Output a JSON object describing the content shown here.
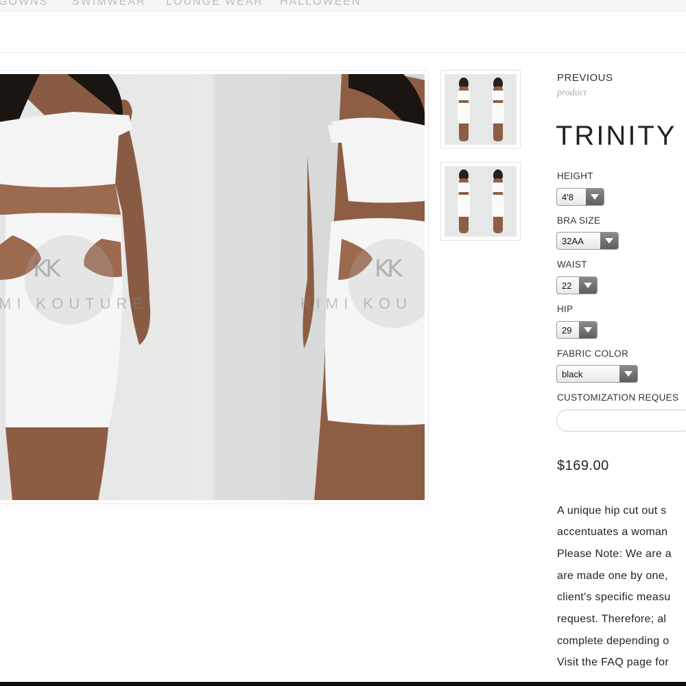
{
  "nav": {
    "items": [
      "GOWNS",
      "SWIMWEAR",
      "LOUNGE WEAR",
      "HALLOWEEN"
    ]
  },
  "gallery": {
    "watermark_left": "MI KOUTURE",
    "watermark_right": "KIMI KOU",
    "logo_mark": "KK"
  },
  "product": {
    "previous_label": "PREVIOUS",
    "previous_sub": "product",
    "title": "TRINITY S",
    "options": {
      "height": {
        "label": "HEIGHT",
        "value": "4'8"
      },
      "bra_size": {
        "label": "BRA SIZE",
        "value": "32AA"
      },
      "waist": {
        "label": "WAIST",
        "value": "22"
      },
      "hip": {
        "label": "HIP",
        "value": "29"
      },
      "fabric_color": {
        "label": "FABRIC COLOR",
        "value": "black"
      },
      "customization": {
        "label": "CUSTOMIZATION REQUES",
        "value": ""
      }
    },
    "price": "$169.00",
    "description": [
      "A unique hip cut out s",
      "accentuates a woman",
      "Please Note: We are a",
      "are made one by one,",
      "client's specific measu",
      "request. Therefore; al",
      "complete depending o",
      "Visit the FAQ page for"
    ]
  }
}
